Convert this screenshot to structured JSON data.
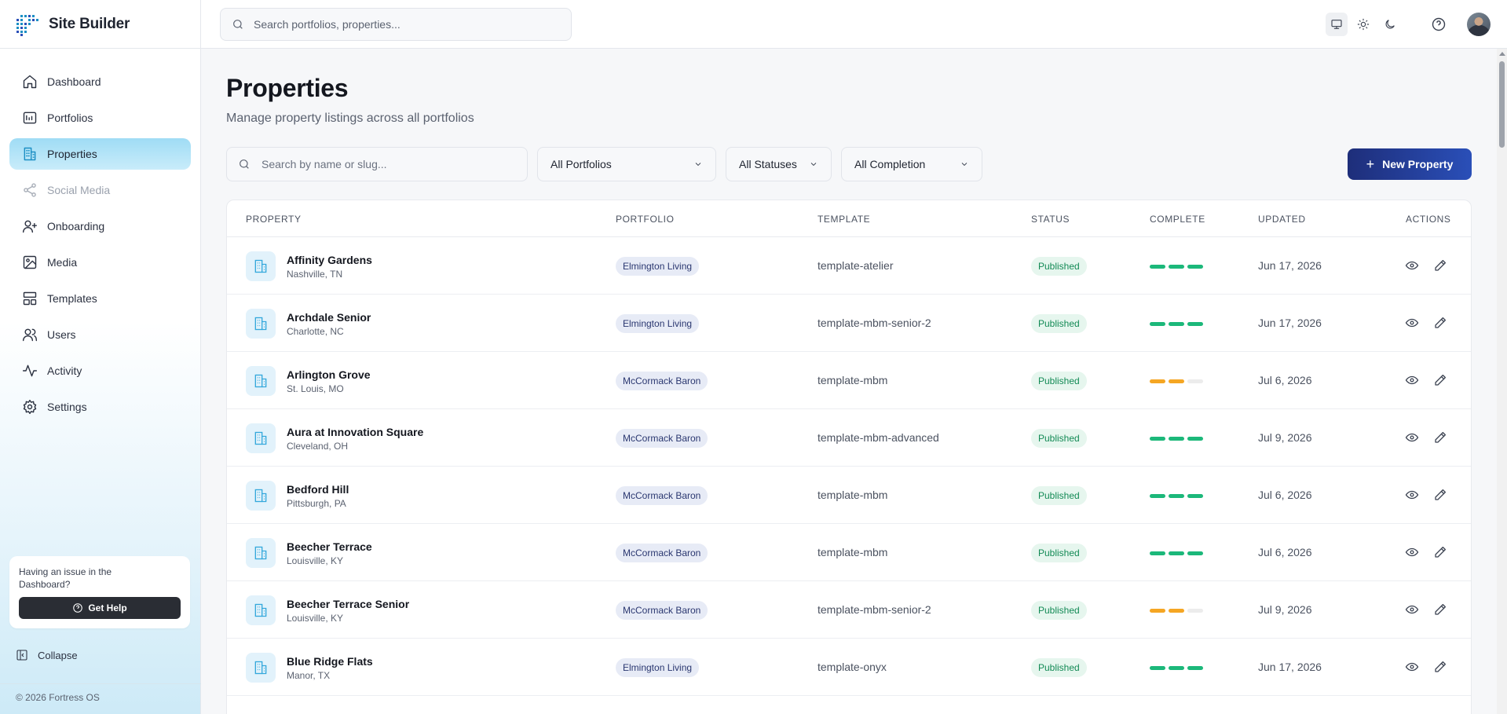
{
  "app": {
    "name": "Site Builder",
    "copyright": "© 2026 Fortress OS"
  },
  "topbar": {
    "search_placeholder": "Search portfolios, properties..."
  },
  "sidebar": {
    "items": [
      {
        "label": "Dashboard",
        "icon": "home-icon"
      },
      {
        "label": "Portfolios",
        "icon": "portfolio-icon"
      },
      {
        "label": "Properties",
        "icon": "building-icon",
        "active": true
      },
      {
        "label": "Social Media",
        "icon": "share-icon",
        "disabled": true
      },
      {
        "label": "Onboarding",
        "icon": "user-plus-icon"
      },
      {
        "label": "Media",
        "icon": "image-icon"
      },
      {
        "label": "Templates",
        "icon": "layout-icon"
      },
      {
        "label": "Users",
        "icon": "users-icon"
      },
      {
        "label": "Activity",
        "icon": "activity-icon"
      },
      {
        "label": "Settings",
        "icon": "gear-icon"
      }
    ],
    "help_text": "Having an issue in the Dashboard?",
    "help_button": "Get Help",
    "collapse_label": "Collapse"
  },
  "page": {
    "title": "Properties",
    "subtitle": "Manage property listings across all portfolios",
    "search_placeholder": "Search by name or slug...",
    "filter_portfolio": "All Portfolios",
    "filter_status": "All Statuses",
    "filter_completion": "All Completion",
    "new_button": "New Property"
  },
  "table": {
    "headers": [
      "PROPERTY",
      "PORTFOLIO",
      "TEMPLATE",
      "STATUS",
      "COMPLETE",
      "UPDATED",
      "ACTIONS"
    ],
    "rows": [
      {
        "name": "Affinity Gardens",
        "location": "Nashville, TN",
        "portfolio": "Elmington Living",
        "template": "template-atelier",
        "status": "Published",
        "complete": 3,
        "updated": "Jun 17, 2026"
      },
      {
        "name": "Archdale Senior",
        "location": "Charlotte, NC",
        "portfolio": "Elmington Living",
        "template": "template-mbm-senior-2",
        "status": "Published",
        "complete": 3,
        "updated": "Jun 17, 2026"
      },
      {
        "name": "Arlington Grove",
        "location": "St. Louis, MO",
        "portfolio": "McCormack Baron",
        "template": "template-mbm",
        "status": "Published",
        "complete": 2,
        "updated": "Jul 6, 2026"
      },
      {
        "name": "Aura at Innovation Square",
        "location": "Cleveland, OH",
        "portfolio": "McCormack Baron",
        "template": "template-mbm-advanced",
        "status": "Published",
        "complete": 3,
        "updated": "Jul 9, 2026"
      },
      {
        "name": "Bedford Hill",
        "location": "Pittsburgh, PA",
        "portfolio": "McCormack Baron",
        "template": "template-mbm",
        "status": "Published",
        "complete": 3,
        "updated": "Jul 6, 2026"
      },
      {
        "name": "Beecher Terrace",
        "location": "Louisville, KY",
        "portfolio": "McCormack Baron",
        "template": "template-mbm",
        "status": "Published",
        "complete": 3,
        "updated": "Jul 6, 2026"
      },
      {
        "name": "Beecher Terrace Senior",
        "location": "Louisville, KY",
        "portfolio": "McCormack Baron",
        "template": "template-mbm-senior-2",
        "status": "Published",
        "complete": 2,
        "updated": "Jul 9, 2026"
      },
      {
        "name": "Blue Ridge Flats",
        "location": "Manor, TX",
        "portfolio": "Elmington Living",
        "template": "template-onyx",
        "status": "Published",
        "complete": 3,
        "updated": "Jun 17, 2026"
      }
    ]
  },
  "colors": {
    "complete_full": "#1cb87a",
    "complete_partial": "#f5a623",
    "complete_empty": "#ececec",
    "accent": "#1e2e7a"
  }
}
